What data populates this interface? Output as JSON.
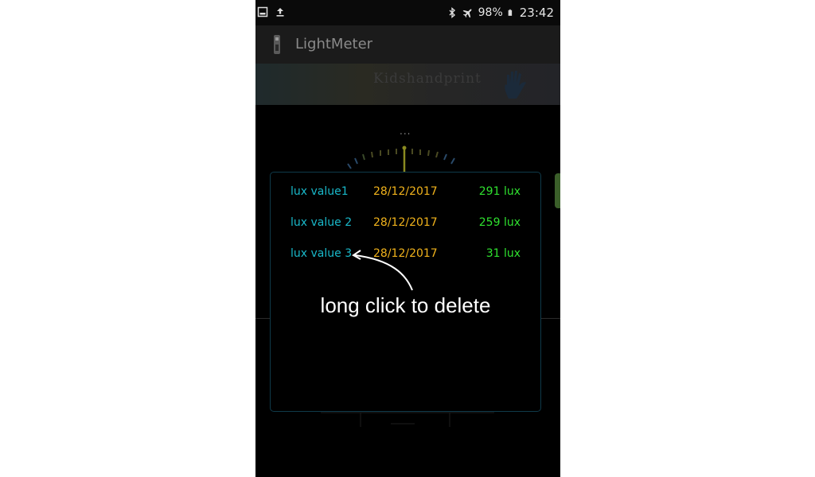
{
  "statusbar": {
    "battery_percent": "98%",
    "time": "23:42",
    "icons": [
      "screenshot-icon",
      "upload-icon",
      "bluetooth-icon",
      "airplane-mode-icon",
      "battery-icon"
    ]
  },
  "appbar": {
    "title": "LightMeter"
  },
  "banner": {
    "text": "Kidshandprint"
  },
  "gauge": {
    "dots": "..."
  },
  "dialog": {
    "rows": [
      {
        "name": "lux value1",
        "date": "28/12/2017",
        "lux": "291 lux"
      },
      {
        "name": "lux value 2",
        "date": "28/12/2017",
        "lux": "259 lux"
      },
      {
        "name": "lux value 3",
        "date": "28/12/2017",
        "lux": "31 lux"
      }
    ],
    "hint": "long click to delete"
  },
  "colors": {
    "name": "#19b8c9",
    "date": "#f1b31c",
    "lux": "#2fe12f",
    "dialog_border": "#0f3a4a"
  }
}
